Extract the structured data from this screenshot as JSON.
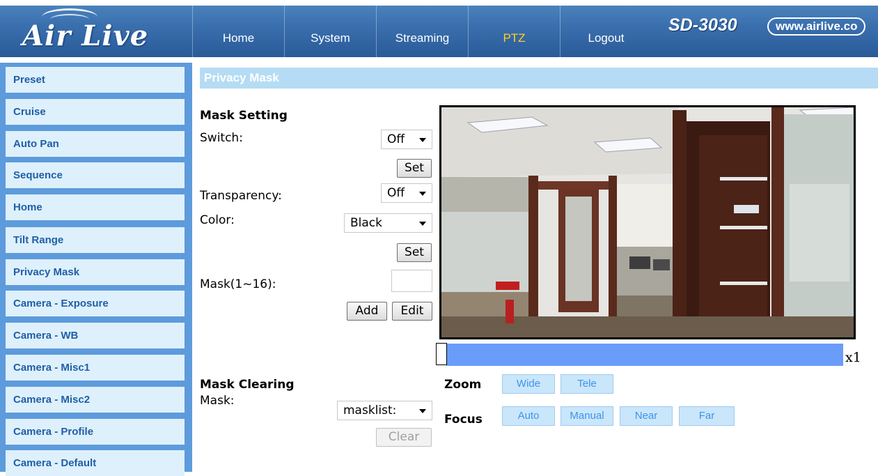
{
  "header": {
    "logo_text": "Air Live",
    "nav": [
      "Home",
      "System",
      "Streaming",
      "PTZ",
      "Logout"
    ],
    "active_nav": "PTZ",
    "model": "SD-3030",
    "url": "www.airlive.co",
    "colors": {
      "header_blue": "#3a6fae",
      "active_nav": "#ffd21e"
    }
  },
  "sidebar": {
    "items": [
      "Preset",
      "Cruise",
      "Auto Pan",
      "Sequence",
      "Home",
      "Tilt Range",
      "Privacy Mask",
      "Camera - Exposure",
      "Camera - WB",
      "Camera - Misc1",
      "Camera - Misc2",
      "Camera - Profile",
      "Camera - Default"
    ]
  },
  "page": {
    "title": "Privacy Mask"
  },
  "mask_setting": {
    "heading": "Mask Setting",
    "switch_label": "Switch:",
    "switch_value": "Off",
    "set_label": "Set",
    "transparency_label": "Transparency:",
    "transparency_value": "Off",
    "color_label": "Color:",
    "color_value": "Black",
    "mask_label": "Mask(1~16):",
    "mask_value": "",
    "add_label": "Add",
    "edit_label": "Edit"
  },
  "mask_clearing": {
    "heading": "Mask Clearing",
    "mask_label": "Mask:",
    "mask_value": "masklist:",
    "clear_label": "Clear"
  },
  "zoom": {
    "level": "x1"
  },
  "controls": {
    "zoom_label": "Zoom",
    "wide": "Wide",
    "tele": "Tele",
    "focus_label": "Focus",
    "auto": "Auto",
    "manual": "Manual",
    "near": "Near",
    "far": "Far"
  }
}
